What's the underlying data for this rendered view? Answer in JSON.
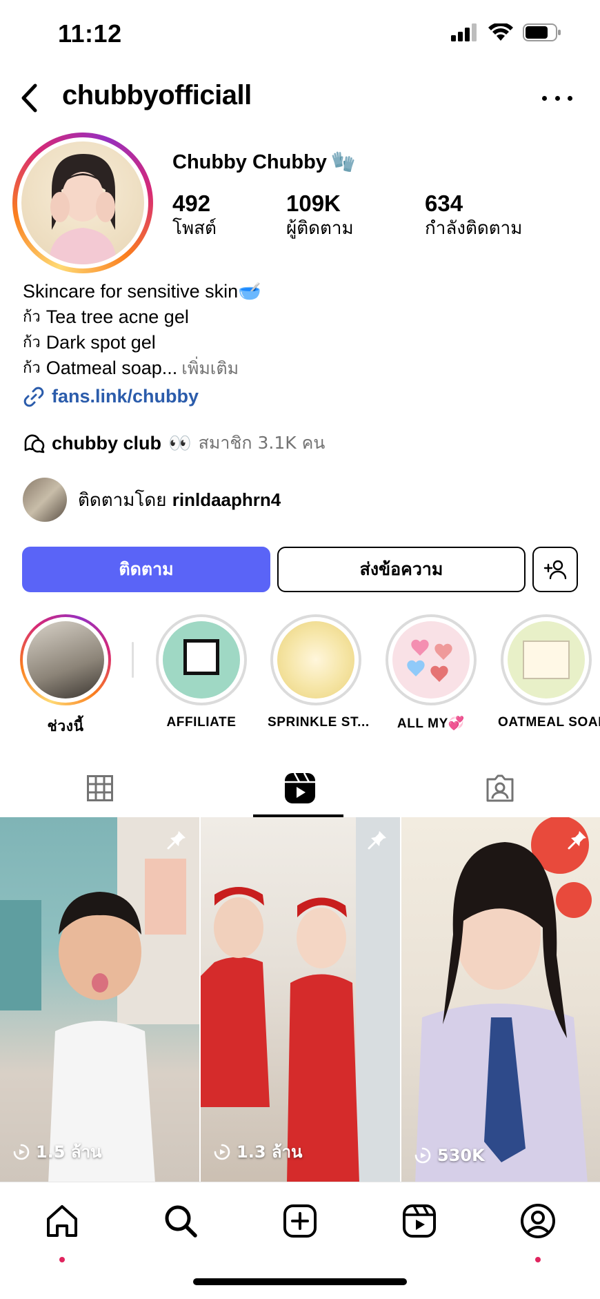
{
  "status": {
    "time": "11:12"
  },
  "header": {
    "username": "chubbyofficiall"
  },
  "profile": {
    "display_name": "Chubby Chubby",
    "name_emoji": "🧤",
    "stats": [
      {
        "value": "492",
        "label": "โพสต์"
      },
      {
        "value": "109K",
        "label": "ผู้ติดตาม"
      },
      {
        "value": "634",
        "label": "กำลังติดตาม"
      }
    ]
  },
  "bio": {
    "line1": "Skincare for sensitive skin🥣",
    "line2": "Tea tree acne gel",
    "line3": "Dark spot gel",
    "line4": "Oatmeal soap",
    "ellipsis": "...",
    "more": "เพิ่มเติม",
    "bullet": "ก้ว",
    "link": "fans.link/chubby"
  },
  "club": {
    "name": "chubby club",
    "emoji": "👀",
    "members": "สมาชิก 3.1K คน"
  },
  "followed_by": {
    "prefix": "ติดตามโดย",
    "user": "rinldaaphrn4"
  },
  "buttons": {
    "follow": "ติดตาม",
    "message": "ส่งข้อความ"
  },
  "highlights": [
    {
      "label": "ช่วงนี้"
    },
    {
      "label": "AFFILIATE"
    },
    {
      "label": "SPRINKLE ST..."
    },
    {
      "label": "ALL MY💞"
    },
    {
      "label": "OATMEAL SOAP"
    }
  ],
  "reels": [
    {
      "views": "1.5 ล้าน"
    },
    {
      "views": "1.3 ล้าน"
    },
    {
      "views": "530K"
    }
  ],
  "colors": {
    "follow_button": "#5a64f7",
    "link": "#2b5cab",
    "notification_dot": "#e0245e"
  }
}
